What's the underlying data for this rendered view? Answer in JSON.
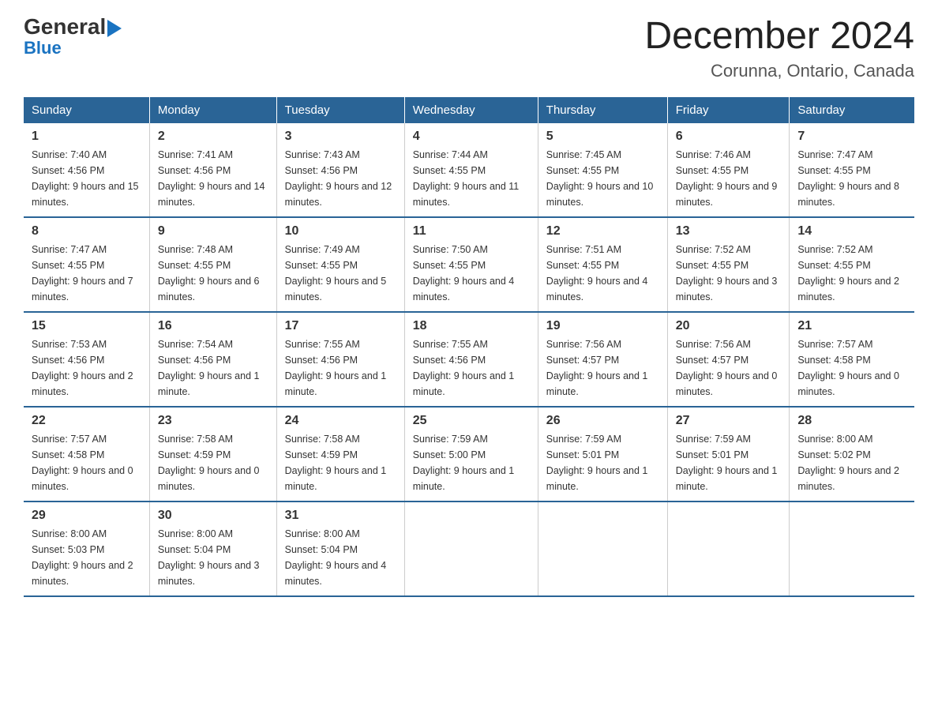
{
  "logo": {
    "general": "General",
    "blue": "Blue",
    "triangle": "▶"
  },
  "title": "December 2024",
  "subtitle": "Corunna, Ontario, Canada",
  "days_of_week": [
    "Sunday",
    "Monday",
    "Tuesday",
    "Wednesday",
    "Thursday",
    "Friday",
    "Saturday"
  ],
  "weeks": [
    [
      {
        "day": "1",
        "sunrise": "7:40 AM",
        "sunset": "4:56 PM",
        "daylight": "9 hours and 15 minutes."
      },
      {
        "day": "2",
        "sunrise": "7:41 AM",
        "sunset": "4:56 PM",
        "daylight": "9 hours and 14 minutes."
      },
      {
        "day": "3",
        "sunrise": "7:43 AM",
        "sunset": "4:56 PM",
        "daylight": "9 hours and 12 minutes."
      },
      {
        "day": "4",
        "sunrise": "7:44 AM",
        "sunset": "4:55 PM",
        "daylight": "9 hours and 11 minutes."
      },
      {
        "day": "5",
        "sunrise": "7:45 AM",
        "sunset": "4:55 PM",
        "daylight": "9 hours and 10 minutes."
      },
      {
        "day": "6",
        "sunrise": "7:46 AM",
        "sunset": "4:55 PM",
        "daylight": "9 hours and 9 minutes."
      },
      {
        "day": "7",
        "sunrise": "7:47 AM",
        "sunset": "4:55 PM",
        "daylight": "9 hours and 8 minutes."
      }
    ],
    [
      {
        "day": "8",
        "sunrise": "7:47 AM",
        "sunset": "4:55 PM",
        "daylight": "9 hours and 7 minutes."
      },
      {
        "day": "9",
        "sunrise": "7:48 AM",
        "sunset": "4:55 PM",
        "daylight": "9 hours and 6 minutes."
      },
      {
        "day": "10",
        "sunrise": "7:49 AM",
        "sunset": "4:55 PM",
        "daylight": "9 hours and 5 minutes."
      },
      {
        "day": "11",
        "sunrise": "7:50 AM",
        "sunset": "4:55 PM",
        "daylight": "9 hours and 4 minutes."
      },
      {
        "day": "12",
        "sunrise": "7:51 AM",
        "sunset": "4:55 PM",
        "daylight": "9 hours and 4 minutes."
      },
      {
        "day": "13",
        "sunrise": "7:52 AM",
        "sunset": "4:55 PM",
        "daylight": "9 hours and 3 minutes."
      },
      {
        "day": "14",
        "sunrise": "7:52 AM",
        "sunset": "4:55 PM",
        "daylight": "9 hours and 2 minutes."
      }
    ],
    [
      {
        "day": "15",
        "sunrise": "7:53 AM",
        "sunset": "4:56 PM",
        "daylight": "9 hours and 2 minutes."
      },
      {
        "day": "16",
        "sunrise": "7:54 AM",
        "sunset": "4:56 PM",
        "daylight": "9 hours and 1 minute."
      },
      {
        "day": "17",
        "sunrise": "7:55 AM",
        "sunset": "4:56 PM",
        "daylight": "9 hours and 1 minute."
      },
      {
        "day": "18",
        "sunrise": "7:55 AM",
        "sunset": "4:56 PM",
        "daylight": "9 hours and 1 minute."
      },
      {
        "day": "19",
        "sunrise": "7:56 AM",
        "sunset": "4:57 PM",
        "daylight": "9 hours and 1 minute."
      },
      {
        "day": "20",
        "sunrise": "7:56 AM",
        "sunset": "4:57 PM",
        "daylight": "9 hours and 0 minutes."
      },
      {
        "day": "21",
        "sunrise": "7:57 AM",
        "sunset": "4:58 PM",
        "daylight": "9 hours and 0 minutes."
      }
    ],
    [
      {
        "day": "22",
        "sunrise": "7:57 AM",
        "sunset": "4:58 PM",
        "daylight": "9 hours and 0 minutes."
      },
      {
        "day": "23",
        "sunrise": "7:58 AM",
        "sunset": "4:59 PM",
        "daylight": "9 hours and 0 minutes."
      },
      {
        "day": "24",
        "sunrise": "7:58 AM",
        "sunset": "4:59 PM",
        "daylight": "9 hours and 1 minute."
      },
      {
        "day": "25",
        "sunrise": "7:59 AM",
        "sunset": "5:00 PM",
        "daylight": "9 hours and 1 minute."
      },
      {
        "day": "26",
        "sunrise": "7:59 AM",
        "sunset": "5:01 PM",
        "daylight": "9 hours and 1 minute."
      },
      {
        "day": "27",
        "sunrise": "7:59 AM",
        "sunset": "5:01 PM",
        "daylight": "9 hours and 1 minute."
      },
      {
        "day": "28",
        "sunrise": "8:00 AM",
        "sunset": "5:02 PM",
        "daylight": "9 hours and 2 minutes."
      }
    ],
    [
      {
        "day": "29",
        "sunrise": "8:00 AM",
        "sunset": "5:03 PM",
        "daylight": "9 hours and 2 minutes."
      },
      {
        "day": "30",
        "sunrise": "8:00 AM",
        "sunset": "5:04 PM",
        "daylight": "9 hours and 3 minutes."
      },
      {
        "day": "31",
        "sunrise": "8:00 AM",
        "sunset": "5:04 PM",
        "daylight": "9 hours and 4 minutes."
      },
      null,
      null,
      null,
      null
    ]
  ]
}
